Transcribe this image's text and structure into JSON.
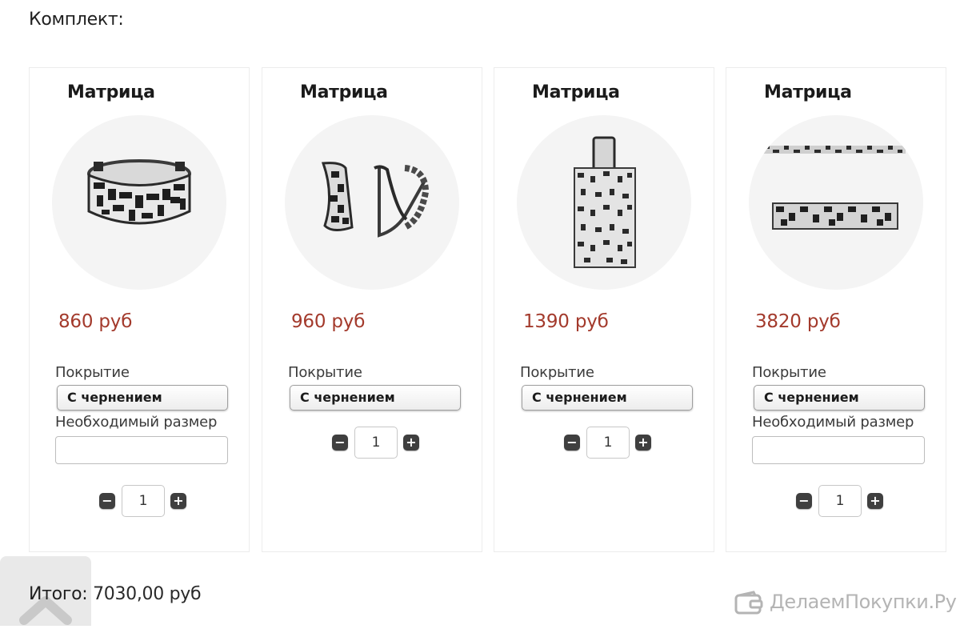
{
  "set": {
    "heading": "Комплект:"
  },
  "products": [
    {
      "title": "Матрица",
      "price": "860 руб",
      "coating_label": "Покрытие",
      "coating_value": "С чернением",
      "size_label": "Необходимый размер",
      "quantity": "1",
      "photo_icon": "ring-icon"
    },
    {
      "title": "Матрица",
      "price": "960 руб",
      "coating_label": "Покрытие",
      "coating_value": "С чернением",
      "quantity": "1",
      "photo_icon": "earrings-icon"
    },
    {
      "title": "Матрица",
      "price": "1390 руб",
      "coating_label": "Покрытие",
      "coating_value": "С чернением",
      "quantity": "1",
      "photo_icon": "pendant-icon"
    },
    {
      "title": "Матрица",
      "price": "3820 руб",
      "coating_label": "Покрытие",
      "coating_value": "С чернением",
      "size_label": "Необходимый размер",
      "quantity": "1",
      "photo_icon": "bracelet-icon"
    }
  ],
  "controls": {
    "minus": "−",
    "plus": "+"
  },
  "total": {
    "label": "Итого:",
    "value": "7030,00 руб"
  },
  "watermark": {
    "text": "ДелаемПокупки.Ру"
  },
  "colors": {
    "price": "#a33a2c",
    "quantity_button": "#3f3f3f",
    "photo_background": "#f4f4f4"
  }
}
